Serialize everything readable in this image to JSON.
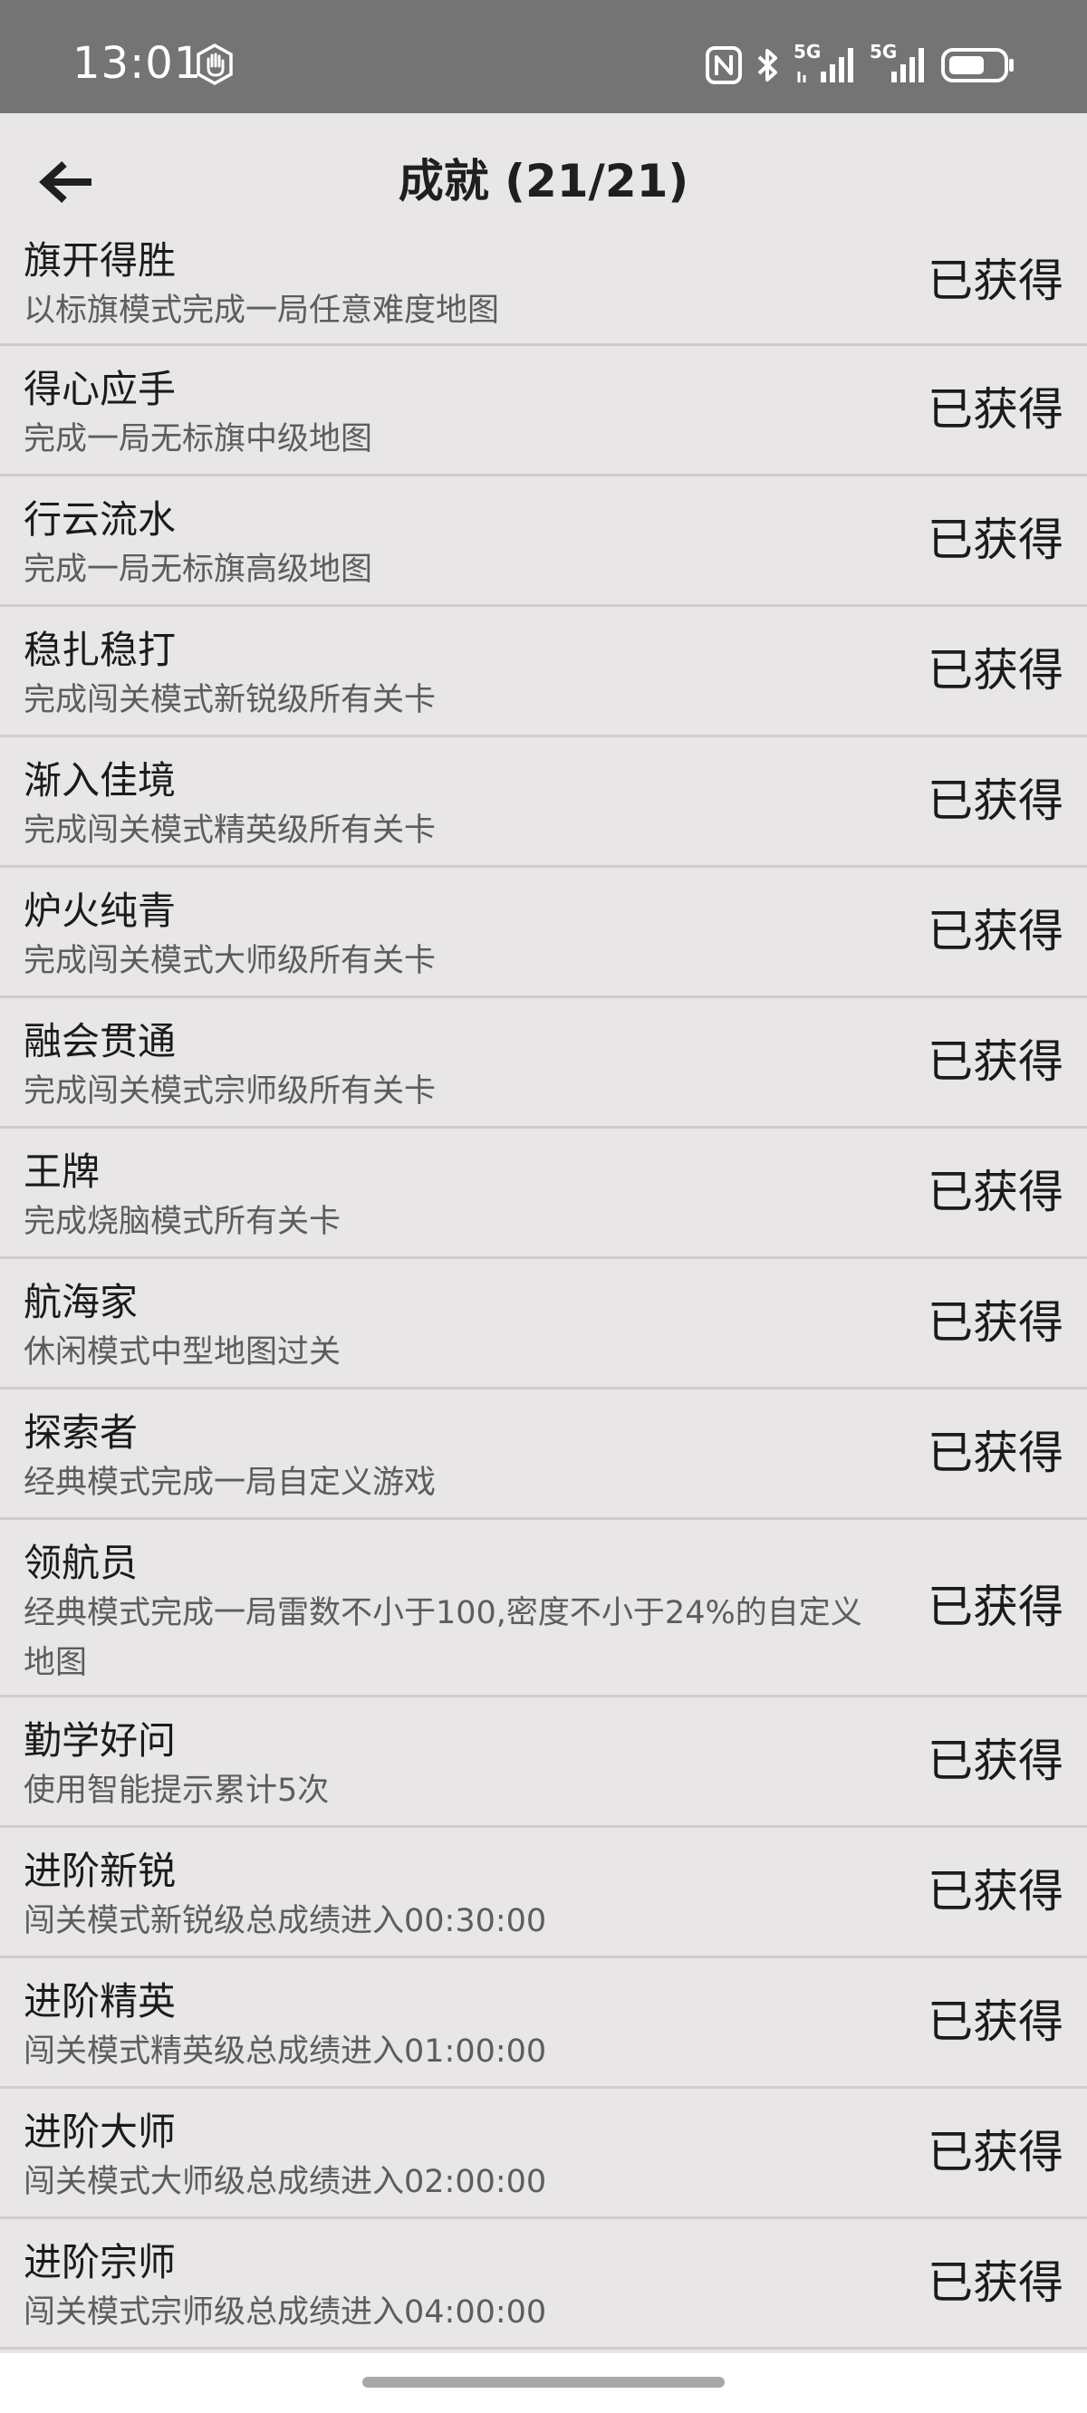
{
  "status_bar": {
    "time": "13:01",
    "network_label_1": "5G",
    "network_label_2": "5G"
  },
  "header": {
    "title": "成就 (21/21)"
  },
  "achievements": [
    {
      "title": "旗开得胜",
      "desc": "以标旗模式完成一局任意难度地图",
      "status": "已获得"
    },
    {
      "title": "得心应手",
      "desc": "完成一局无标旗中级地图",
      "status": "已获得"
    },
    {
      "title": "行云流水",
      "desc": "完成一局无标旗高级地图",
      "status": "已获得"
    },
    {
      "title": "稳扎稳打",
      "desc": "完成闯关模式新锐级所有关卡",
      "status": "已获得"
    },
    {
      "title": "渐入佳境",
      "desc": "完成闯关模式精英级所有关卡",
      "status": "已获得"
    },
    {
      "title": "炉火纯青",
      "desc": "完成闯关模式大师级所有关卡",
      "status": "已获得"
    },
    {
      "title": "融会贯通",
      "desc": "完成闯关模式宗师级所有关卡",
      "status": "已获得"
    },
    {
      "title": "王牌",
      "desc": "完成烧脑模式所有关卡",
      "status": "已获得"
    },
    {
      "title": "航海家",
      "desc": "休闲模式中型地图过关",
      "status": "已获得"
    },
    {
      "title": "探索者",
      "desc": "经典模式完成一局自定义游戏",
      "status": "已获得"
    },
    {
      "title": "领航员",
      "desc": "经典模式完成一局雷数不小于100,密度不小于24%的自定义地图",
      "status": "已获得"
    },
    {
      "title": "勤学好问",
      "desc": "使用智能提示累计5次",
      "status": "已获得"
    },
    {
      "title": "进阶新锐",
      "desc": "闯关模式新锐级总成绩进入00:30:00",
      "status": "已获得"
    },
    {
      "title": "进阶精英",
      "desc": "闯关模式精英级总成绩进入01:00:00",
      "status": "已获得"
    },
    {
      "title": "进阶大师",
      "desc": "闯关模式大师级总成绩进入02:00:00",
      "status": "已获得"
    },
    {
      "title": "进阶宗师",
      "desc": "闯关模式宗师级总成绩进入04:00:00",
      "status": "已获得"
    }
  ],
  "icons": {
    "back": "arrow-left-icon",
    "hand": "hand-icon",
    "nfc": "nfc-icon",
    "bluetooth": "bluetooth-icon",
    "signal": "signal-icon",
    "battery": "battery-icon"
  },
  "colors": {
    "status_bar_bg": "#747474",
    "page_bg": "#e8e6e6",
    "divider": "#cfcdcd",
    "title_text": "#1b1b1b",
    "desc_text": "#5d5d5d"
  }
}
